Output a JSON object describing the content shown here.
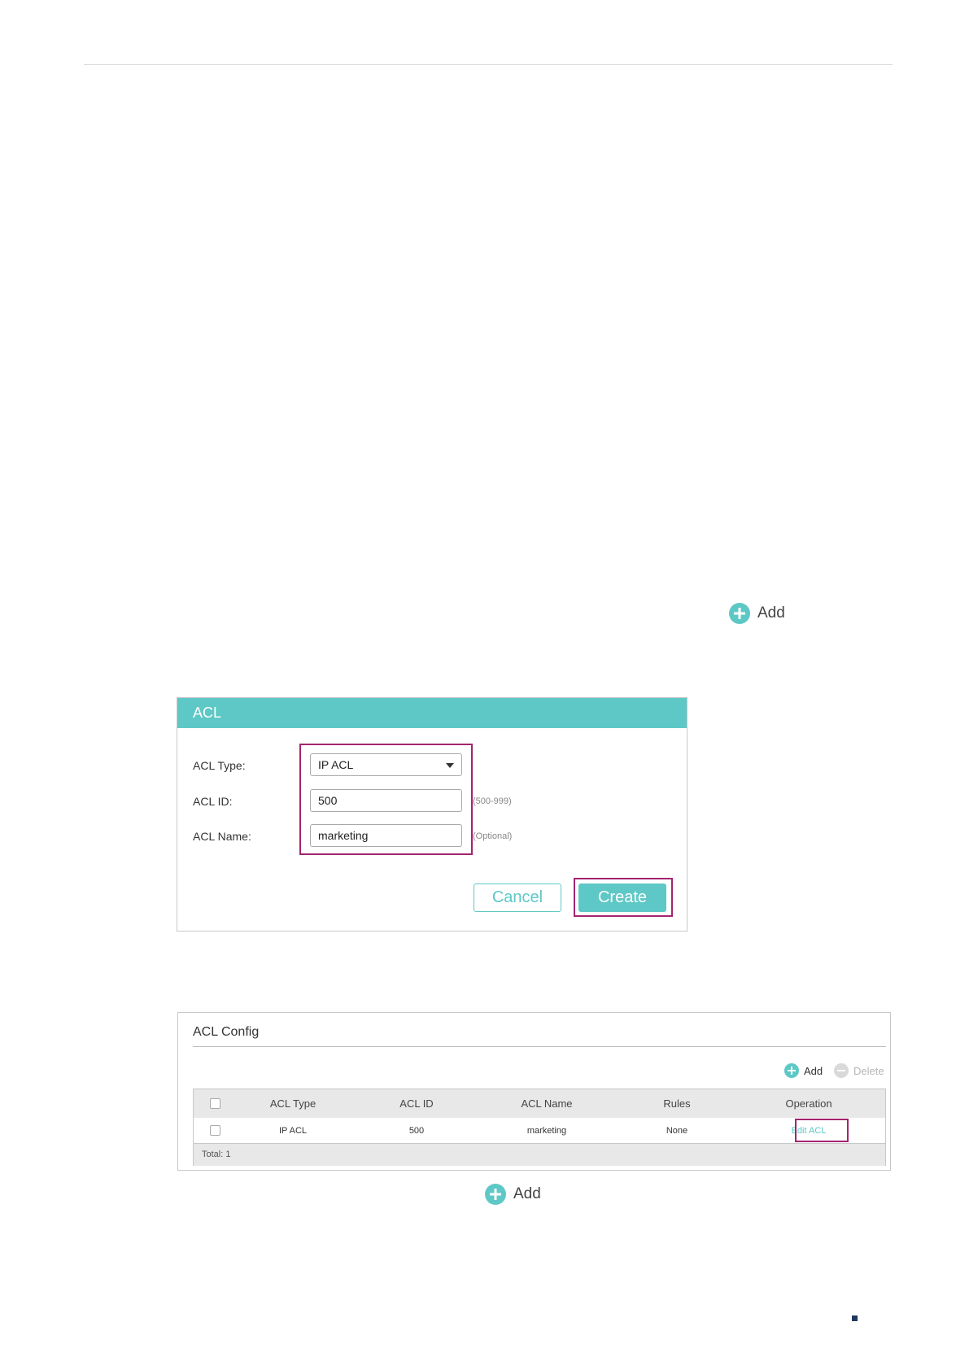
{
  "step_add": {
    "label": "Add"
  },
  "dialog": {
    "title": "ACL",
    "acl_type": {
      "label": "ACL Type:",
      "value": "IP ACL"
    },
    "acl_id": {
      "label": "ACL ID:",
      "value": "500",
      "hint": "(500-999)"
    },
    "acl_name": {
      "label": "ACL Name:",
      "value": "marketing",
      "hint": "(Optional)"
    },
    "cancel_label": "Cancel",
    "create_label": "Create",
    "accent_color": "#5ec8c6",
    "highlight_color": "#a3246f"
  },
  "acl_config": {
    "title": "ACL Config",
    "add_label": "Add",
    "delete_label": "Delete",
    "columns": [
      "ACL Type",
      "ACL ID",
      "ACL Name",
      "Rules",
      "Operation"
    ],
    "rows": [
      {
        "type": "IP ACL",
        "id": "500",
        "name": "marketing",
        "rules": "None",
        "operation": "Edit ACL"
      }
    ],
    "total": "Total: 1"
  },
  "bottom_add": {
    "label": "Add"
  }
}
